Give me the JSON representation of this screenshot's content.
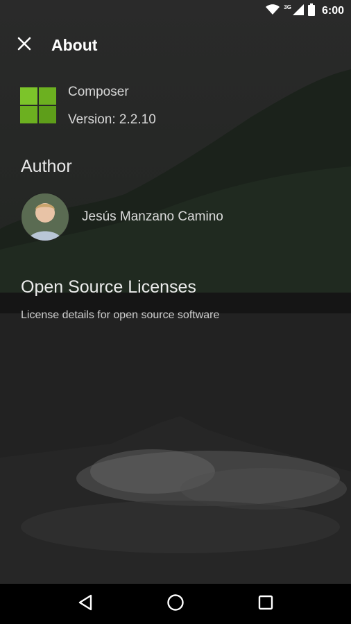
{
  "status_bar": {
    "time": "6:00",
    "network_label": "3G",
    "icons": [
      "wifi-icon",
      "signal-icon",
      "battery-icon"
    ]
  },
  "toolbar": {
    "close_icon": "close-icon",
    "title": "About"
  },
  "app": {
    "icon": "app-grid-icon",
    "name": "Composer",
    "version": "Version: 2.2.10",
    "icon_color": "#7cc42a"
  },
  "author": {
    "section_title": "Author",
    "name": "Jesús Manzano Camino",
    "avatar": "avatar"
  },
  "licenses": {
    "title": "Open Source Licenses",
    "subtitle": "License details for open source software"
  },
  "nav_bar": {
    "icons": [
      "back-icon",
      "home-icon",
      "recents-icon"
    ]
  }
}
